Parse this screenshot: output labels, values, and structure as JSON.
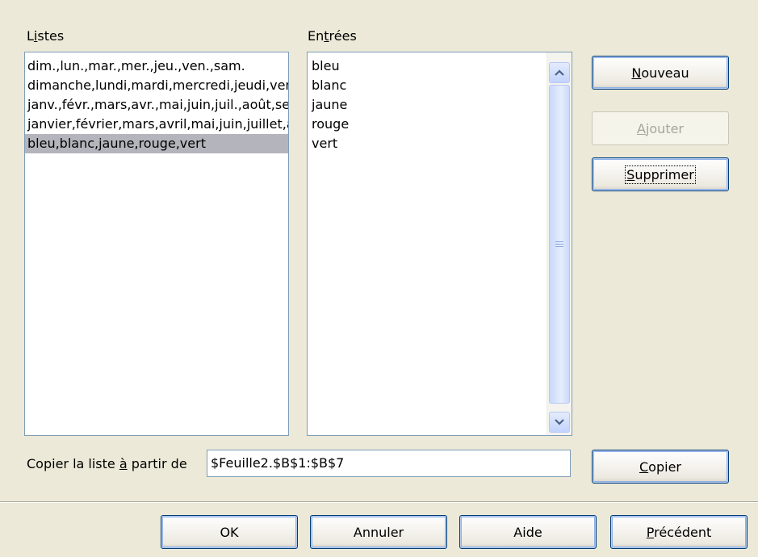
{
  "listes": {
    "label_pre": "L",
    "label_accel": "i",
    "label_post": "stes",
    "items": [
      "dim.,lun.,mar.,mer.,jeu.,ven.,sam.",
      "dimanche,lundi,mardi,mercredi,jeudi,vendredi,samedi",
      "janv.,févr.,mars,avr.,mai,juin,juil.,août,sept.,oct.,nov.,déc.",
      "janvier,février,mars,avril,mai,juin,juillet,août,septembre,octobre,novembre,décembre",
      "bleu,blanc,jaune,rouge,vert"
    ],
    "selected_index": 4
  },
  "entrees": {
    "label_pre": "En",
    "label_accel": "t",
    "label_post": "rées",
    "items": [
      "bleu",
      "blanc",
      "jaune",
      "rouge",
      "vert"
    ]
  },
  "buttons": {
    "nouveau": {
      "accel": "N",
      "rest": "ouveau"
    },
    "ajouter": {
      "accel": "A",
      "rest": "jouter"
    },
    "supprimer": {
      "accel": "S",
      "rest": "upprimer"
    },
    "copier": {
      "accel": "C",
      "rest": "opier"
    }
  },
  "copy_from": {
    "label_pre": "Copier la liste ",
    "label_accel": "à",
    "label_post": " partir de",
    "value": "$Feuille2.$B$1:$B$7"
  },
  "footer": {
    "ok": "OK",
    "annuler": "Annuler",
    "aide": "Aide",
    "precedent_accel": "P",
    "precedent_rest": "récédent"
  },
  "icons": {
    "scroll_up": "chevron-up-icon",
    "scroll_down": "chevron-down-icon"
  },
  "colors": {
    "dialog_bg": "#ece9d8",
    "selection": "#b4b4bc",
    "border": "#7f9db9",
    "button_border": "#003c74"
  }
}
